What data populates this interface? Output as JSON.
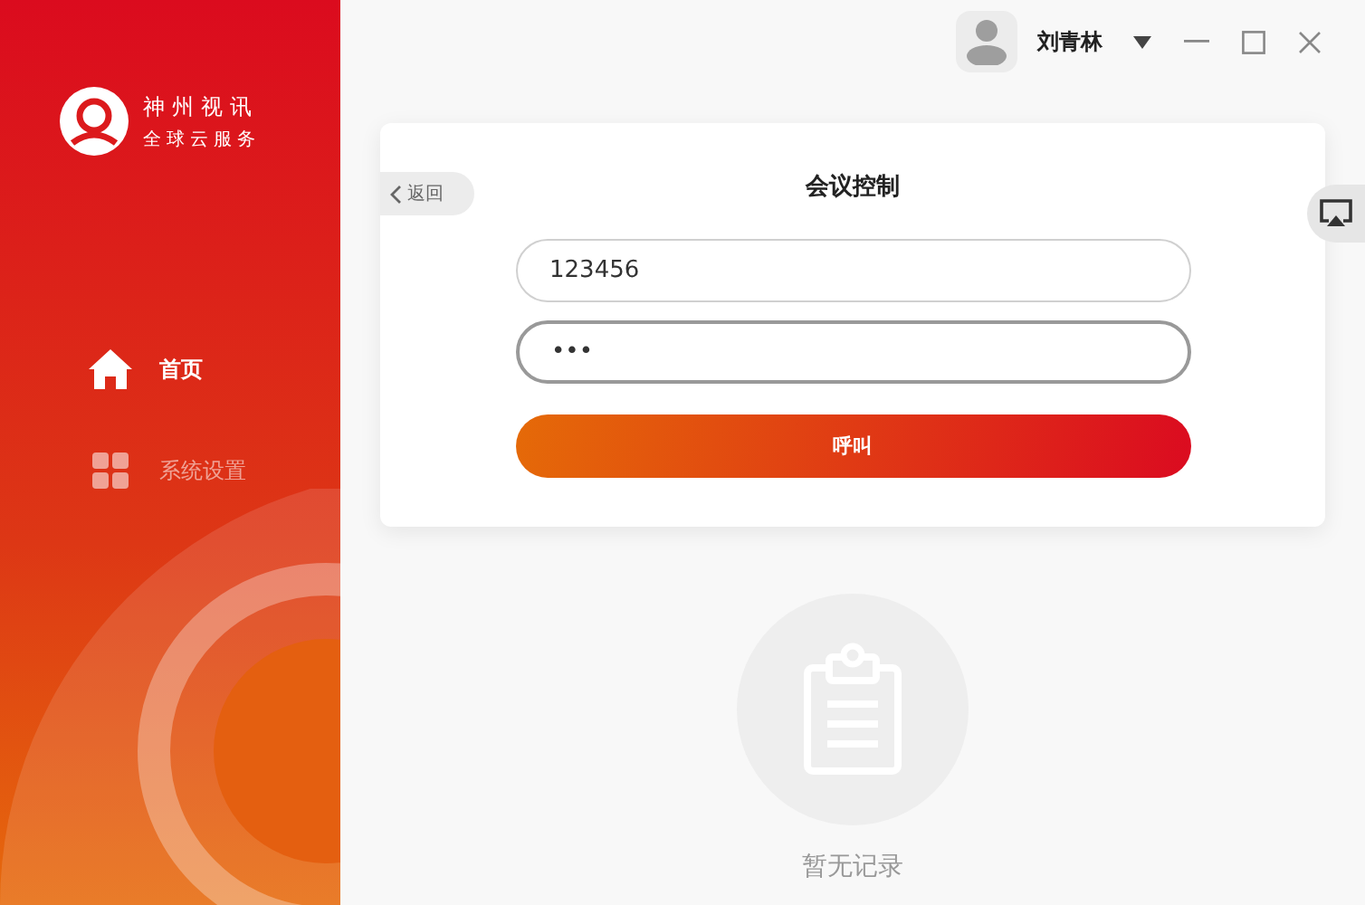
{
  "sidebar": {
    "brand": {
      "name": "神州视讯",
      "tagline": "全球云服务"
    },
    "items": [
      {
        "label": "首页",
        "kind": "home",
        "selected": true
      },
      {
        "label": "系统设置",
        "kind": "settings",
        "selected": false
      }
    ]
  },
  "topbar": {
    "user_name": "刘青林"
  },
  "card": {
    "back_label": "返回",
    "title": "会议控制",
    "fields": [
      {
        "value": "123456",
        "focused": false
      },
      {
        "value": "•••",
        "focused": true
      }
    ],
    "call_button": "呼叫"
  },
  "empty_state": {
    "text": "暂无记录"
  }
}
